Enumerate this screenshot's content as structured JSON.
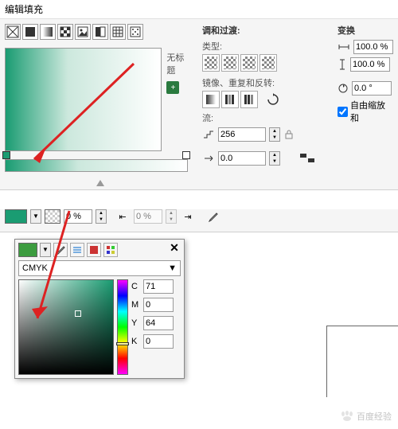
{
  "title": "编辑填充",
  "left": {
    "no_title": "无标题"
  },
  "harmony": {
    "section": "调和过渡:",
    "type_label": "类型:",
    "mirror_label": "镜像、重复和反转:",
    "flow_label": "流:",
    "flow_value": "256",
    "offset_value": "0.0"
  },
  "transform": {
    "section": "变换",
    "width_value": "100.0 %",
    "height_value": "100.0 %",
    "rotate_value": "0.0 °",
    "free_scale": "自由缩放和"
  },
  "node": {
    "opacity": "0 %",
    "position": "0 %"
  },
  "picker": {
    "model": "CMYK",
    "c_label": "C",
    "c": "71",
    "m_label": "M",
    "m": "0",
    "y_label": "Y",
    "y": "64",
    "k_label": "K",
    "k": "0"
  },
  "watermark": "百度经验"
}
